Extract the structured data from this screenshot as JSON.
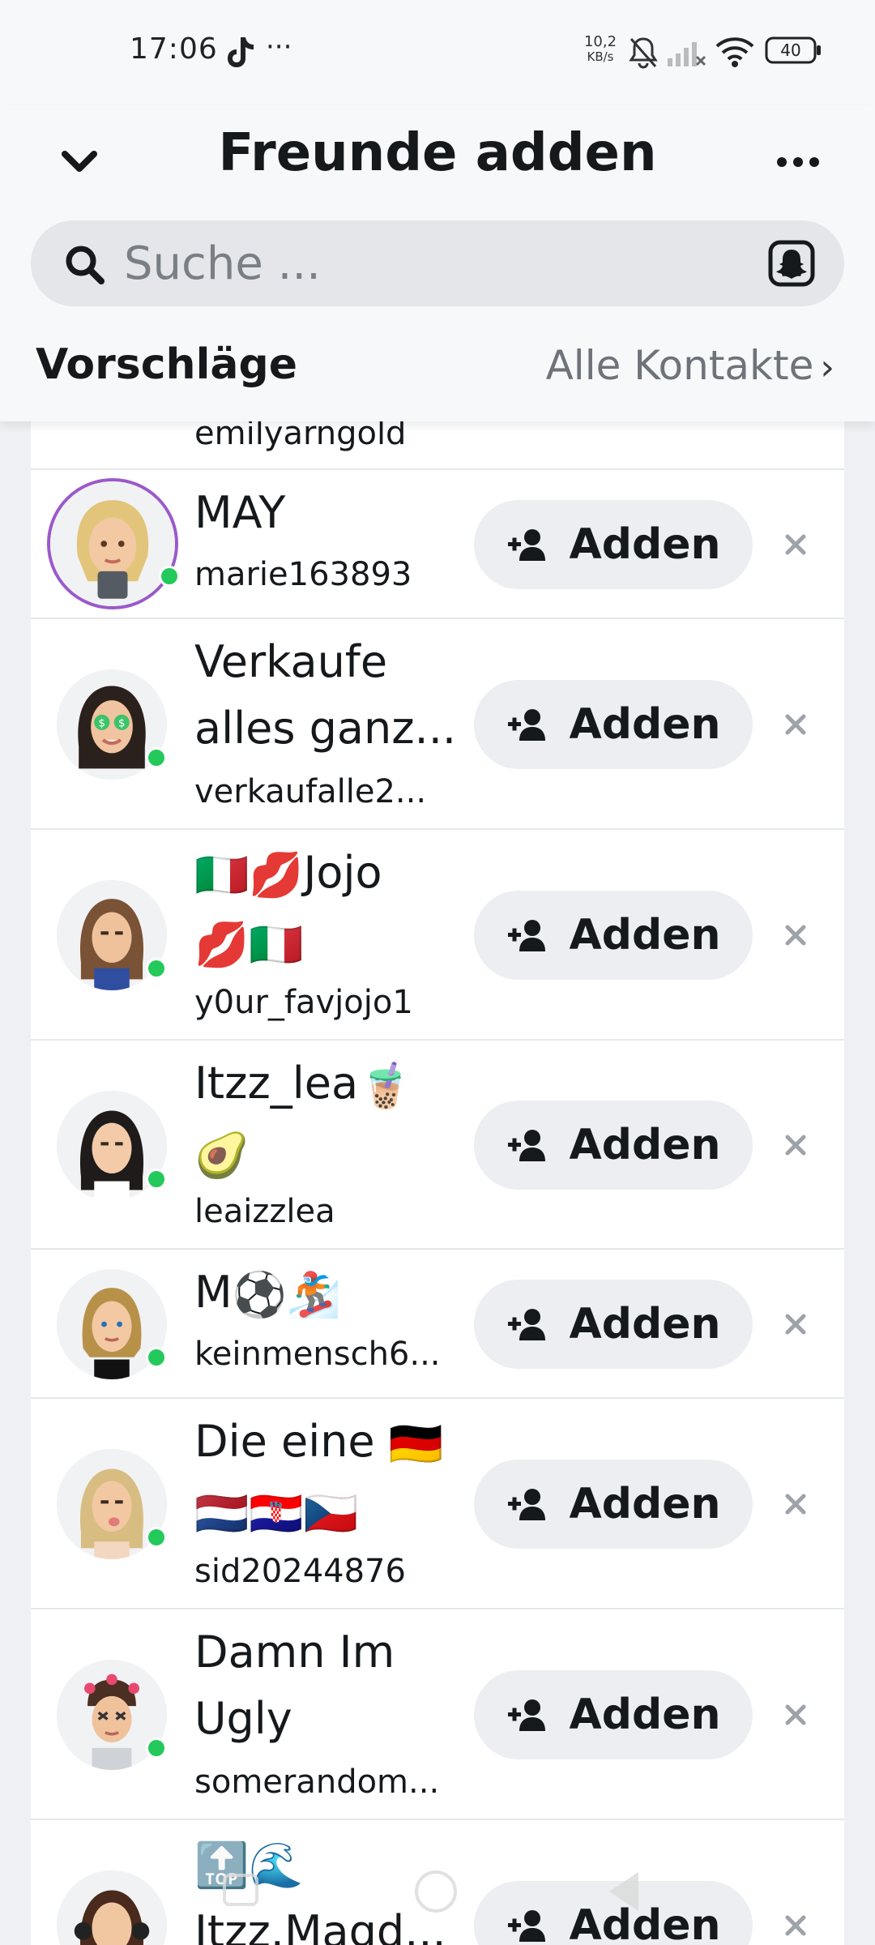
{
  "status_bar": {
    "time": "17:06",
    "more": "···",
    "speed_value": "10,2",
    "speed_unit": "KB/s",
    "battery": "40",
    "icons": [
      "tiktok-icon",
      "bell-off-icon",
      "signal-icon",
      "wifi-icon",
      "battery-icon"
    ]
  },
  "header": {
    "title": "Freunde adden",
    "back_icon": "chevron-down-icon",
    "more_icon": "more-dots-icon"
  },
  "search": {
    "placeholder": "Suche ...",
    "icon": "search-icon",
    "right_icon": "snapchat-ghost-icon"
  },
  "section": {
    "title": "Vorschläge",
    "link": "Alle Kontakte"
  },
  "add_label": "Adden",
  "partial_row": {
    "username": "emilyarngold"
  },
  "rows": [
    {
      "name": "MAY",
      "username": "marie163893",
      "online": true,
      "story_ring": true
    },
    {
      "name": "Verkaufe alles ganz...",
      "username": "verkaufalle2...",
      "online": true
    },
    {
      "name": "Jojo",
      "name_emojis": [
        "🇮🇹",
        "💋",
        "💋",
        "🇮🇹"
      ],
      "username": "y0ur_favjojo1",
      "online": true
    },
    {
      "name": "Itzz_lea",
      "name_emojis": [
        "🧋",
        "🥑"
      ],
      "username": "leaizzlea",
      "online": true
    },
    {
      "name": "M",
      "name_emojis": [
        "⚽",
        "🏂"
      ],
      "username": "keinmensch6...",
      "online": true
    },
    {
      "name": "Die eine",
      "name_emojis": [
        "🇩🇪",
        "🇳🇱",
        "🇭🇷",
        "🇨🇿"
      ],
      "username": "sid20244876",
      "online": true
    },
    {
      "name": "Damn Im Ugly",
      "username": "somerandom...",
      "online": true
    },
    {
      "name": "Itzz.Magd...",
      "name_emojis": [
        "🔝",
        "🌊"
      ],
      "username": "",
      "online": false
    }
  ],
  "colors": {
    "accent_ring": "#9b59c9",
    "online": "#24c95b",
    "button_bg": "#eceef1"
  }
}
